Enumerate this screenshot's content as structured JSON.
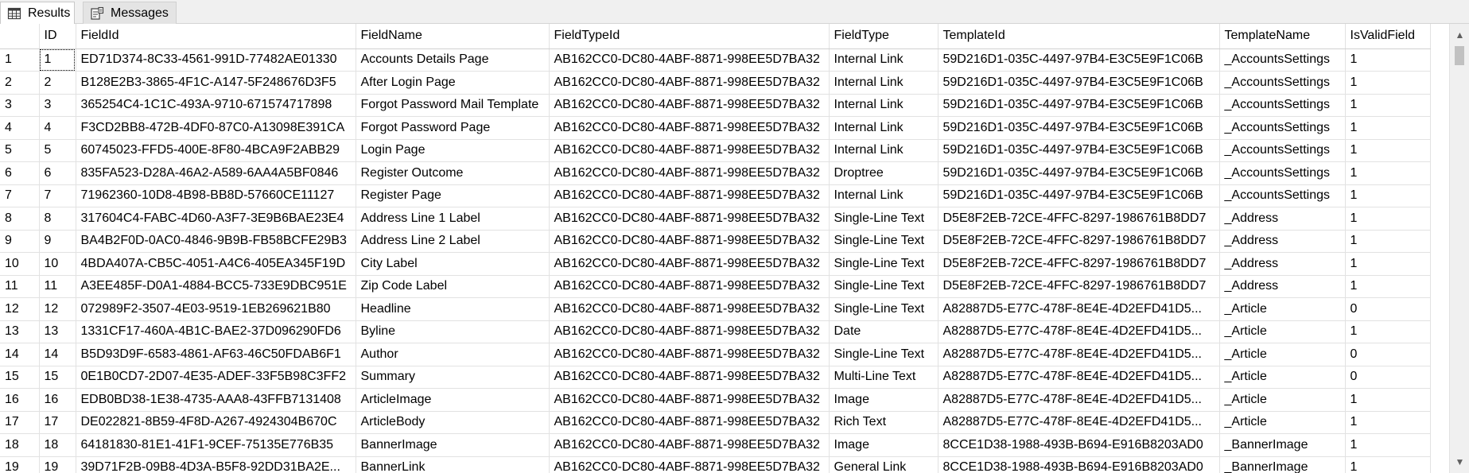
{
  "tabs": [
    {
      "label": "Results",
      "icon": "grid-icon",
      "active": true
    },
    {
      "label": "Messages",
      "icon": "messages-icon",
      "active": false
    }
  ],
  "columns": [
    "",
    "ID",
    "FieldId",
    "FieldName",
    "FieldTypeId",
    "FieldType",
    "TemplateId",
    "TemplateName",
    "IsValidField"
  ],
  "rows": [
    [
      "1",
      "1",
      "ED71D374-8C33-4561-991D-77482AE01330",
      "Accounts Details Page",
      "AB162CC0-DC80-4ABF-8871-998EE5D7BA32",
      "Internal Link",
      "59D216D1-035C-4497-97B4-E3C5E9F1C06B",
      "_AccountsSettings",
      "1"
    ],
    [
      "2",
      "2",
      "B128E2B3-3865-4F1C-A147-5F248676D3F5",
      "After Login Page",
      "AB162CC0-DC80-4ABF-8871-998EE5D7BA32",
      "Internal Link",
      "59D216D1-035C-4497-97B4-E3C5E9F1C06B",
      "_AccountsSettings",
      "1"
    ],
    [
      "3",
      "3",
      "365254C4-1C1C-493A-9710-671574717898",
      "Forgot Password Mail Template",
      "AB162CC0-DC80-4ABF-8871-998EE5D7BA32",
      "Internal Link",
      "59D216D1-035C-4497-97B4-E3C5E9F1C06B",
      "_AccountsSettings",
      "1"
    ],
    [
      "4",
      "4",
      "F3CD2BB8-472B-4DF0-87C0-A13098E391CA",
      "Forgot Password Page",
      "AB162CC0-DC80-4ABF-8871-998EE5D7BA32",
      "Internal Link",
      "59D216D1-035C-4497-97B4-E3C5E9F1C06B",
      "_AccountsSettings",
      "1"
    ],
    [
      "5",
      "5",
      "60745023-FFD5-400E-8F80-4BCA9F2ABB29",
      "Login Page",
      "AB162CC0-DC80-4ABF-8871-998EE5D7BA32",
      "Internal Link",
      "59D216D1-035C-4497-97B4-E3C5E9F1C06B",
      "_AccountsSettings",
      "1"
    ],
    [
      "6",
      "6",
      "835FA523-D28A-46A2-A589-6AA4A5BF0846",
      "Register Outcome",
      "AB162CC0-DC80-4ABF-8871-998EE5D7BA32",
      "Droptree",
      "59D216D1-035C-4497-97B4-E3C5E9F1C06B",
      "_AccountsSettings",
      "1"
    ],
    [
      "7",
      "7",
      "71962360-10D8-4B98-BB8D-57660CE11127",
      "Register Page",
      "AB162CC0-DC80-4ABF-8871-998EE5D7BA32",
      "Internal Link",
      "59D216D1-035C-4497-97B4-E3C5E9F1C06B",
      "_AccountsSettings",
      "1"
    ],
    [
      "8",
      "8",
      "317604C4-FABC-4D60-A3F7-3E9B6BAE23E4",
      "Address Line 1 Label",
      "AB162CC0-DC80-4ABF-8871-998EE5D7BA32",
      "Single-Line Text",
      "D5E8F2EB-72CE-4FFC-8297-1986761B8DD7",
      "_Address",
      "1"
    ],
    [
      "9",
      "9",
      "BA4B2F0D-0AC0-4846-9B9B-FB58BCFE29B3",
      "Address Line 2 Label",
      "AB162CC0-DC80-4ABF-8871-998EE5D7BA32",
      "Single-Line Text",
      "D5E8F2EB-72CE-4FFC-8297-1986761B8DD7",
      "_Address",
      "1"
    ],
    [
      "10",
      "10",
      "4BDA407A-CB5C-4051-A4C6-405EA345F19D",
      "City Label",
      "AB162CC0-DC80-4ABF-8871-998EE5D7BA32",
      "Single-Line Text",
      "D5E8F2EB-72CE-4FFC-8297-1986761B8DD7",
      "_Address",
      "1"
    ],
    [
      "11",
      "11",
      "A3EE485F-D0A1-4884-BCC5-733E9DBC951E",
      "Zip Code Label",
      "AB162CC0-DC80-4ABF-8871-998EE5D7BA32",
      "Single-Line Text",
      "D5E8F2EB-72CE-4FFC-8297-1986761B8DD7",
      "_Address",
      "1"
    ],
    [
      "12",
      "12",
      "072989F2-3507-4E03-9519-1EB269621B80",
      "Headline",
      "AB162CC0-DC80-4ABF-8871-998EE5D7BA32",
      "Single-Line Text",
      "A82887D5-E77C-478F-8E4E-4D2EFD41D5...",
      "_Article",
      "0"
    ],
    [
      "13",
      "13",
      "1331CF17-460A-4B1C-BAE2-37D096290FD6",
      "Byline",
      "AB162CC0-DC80-4ABF-8871-998EE5D7BA32",
      "Date",
      "A82887D5-E77C-478F-8E4E-4D2EFD41D5...",
      "_Article",
      "1"
    ],
    [
      "14",
      "14",
      "B5D93D9F-6583-4861-AF63-46C50FDAB6F1",
      "Author",
      "AB162CC0-DC80-4ABF-8871-998EE5D7BA32",
      "Single-Line Text",
      "A82887D5-E77C-478F-8E4E-4D2EFD41D5...",
      "_Article",
      "0"
    ],
    [
      "15",
      "15",
      "0E1B0CD7-2D07-4E35-ADEF-33F5B98C3FF2",
      "Summary",
      "AB162CC0-DC80-4ABF-8871-998EE5D7BA32",
      "Multi-Line Text",
      "A82887D5-E77C-478F-8E4E-4D2EFD41D5...",
      "_Article",
      "0"
    ],
    [
      "16",
      "16",
      "EDB0BD38-1E38-4735-AAA8-43FFB7131408",
      "ArticleImage",
      "AB162CC0-DC80-4ABF-8871-998EE5D7BA32",
      "Image",
      "A82887D5-E77C-478F-8E4E-4D2EFD41D5...",
      "_Article",
      "1"
    ],
    [
      "17",
      "17",
      "DE022821-8B59-4F8D-A267-4924304B670C",
      "ArticleBody",
      "AB162CC0-DC80-4ABF-8871-998EE5D7BA32",
      "Rich Text",
      "A82887D5-E77C-478F-8E4E-4D2EFD41D5...",
      "_Article",
      "1"
    ],
    [
      "18",
      "18",
      "64181830-81E1-41F1-9CEF-75135E776B35",
      "BannerImage",
      "AB162CC0-DC80-4ABF-8871-998EE5D7BA32",
      "Image",
      "8CCE1D38-1988-493B-B694-E916B8203AD0",
      "_BannerImage",
      "1"
    ],
    [
      "19",
      "19",
      "39D71F2B-09B8-4D3A-B5F8-92DD31BA2E...",
      "BannerLink",
      "AB162CC0-DC80-4ABF-8871-998EE5D7BA32",
      "General Link",
      "8CCE1D38-1988-493B-B694-E916B8203AD0",
      "_BannerImage",
      "1"
    ]
  ],
  "scrollbar": {
    "up_icon": "scroll-up-arrow-icon",
    "down_icon": "scroll-down-arrow-icon"
  }
}
